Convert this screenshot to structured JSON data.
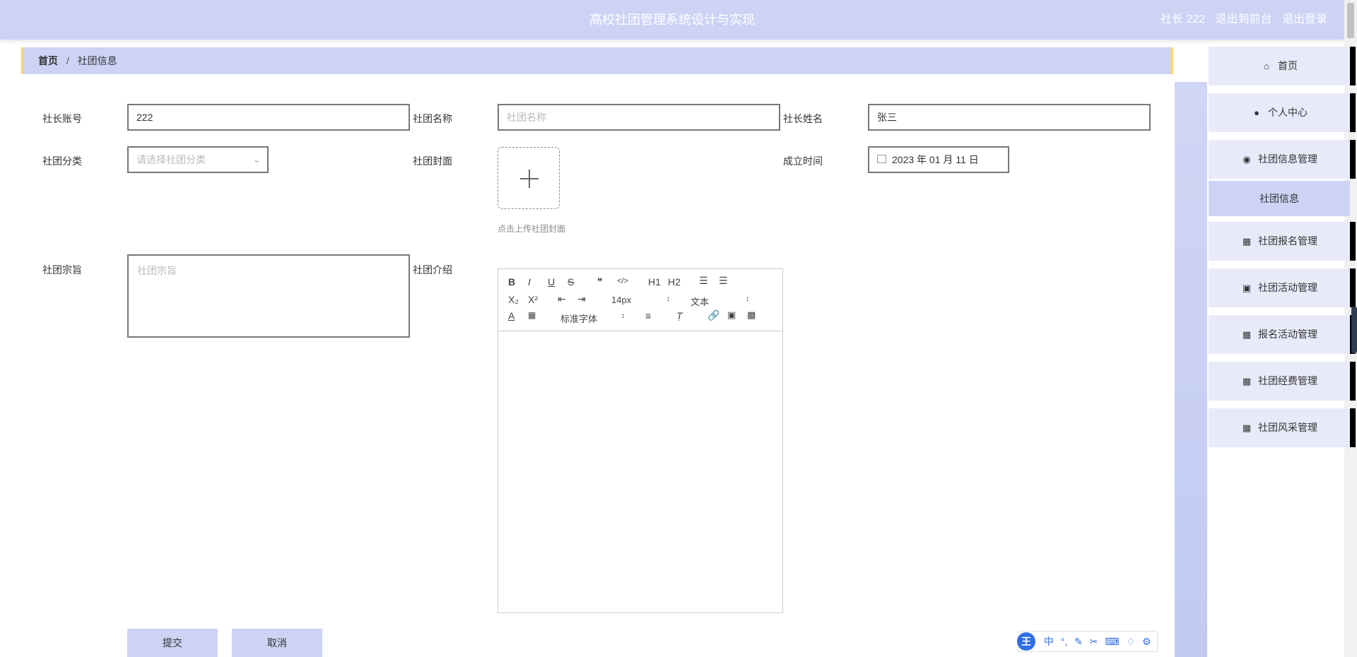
{
  "header": {
    "title": "高校社团管理系统设计与实现",
    "user": "社长 222",
    "links": [
      "退出到前台",
      "退出登录"
    ]
  },
  "breadcrumb": {
    "home": "首页",
    "separator": "/",
    "current": "社团信息"
  },
  "form": {
    "president_account": {
      "label": "社长账号",
      "value": "222"
    },
    "club_name": {
      "label": "社团名称",
      "placeholder": "社团名称"
    },
    "president_name": {
      "label": "社长姓名",
      "value": "张三"
    },
    "category": {
      "label": "社团分类",
      "placeholder": "请选择社团分类"
    },
    "cover": {
      "label": "社团封面",
      "hint": "点击上传社团封面"
    },
    "founded": {
      "label": "成立时间",
      "value": "2023 年 01 月 11 日"
    },
    "purpose": {
      "label": "社团宗旨",
      "placeholder": "社团宗旨"
    },
    "intro": {
      "label": "社团介绍"
    }
  },
  "editor": {
    "buttons_row1": [
      "B",
      "I",
      "U",
      "S",
      "❞",
      "</>",
      "H1",
      "H2"
    ],
    "buttons_row2": [
      "X₂",
      "X²"
    ],
    "font_size": "14px",
    "text_type": "文本",
    "font_family": "标准字体"
  },
  "actions": {
    "submit": "提交",
    "cancel": "取消"
  },
  "sidebar": {
    "items": [
      {
        "label": "首页",
        "icon": "home-icon"
      },
      {
        "label": "个人中心",
        "icon": "user-icon"
      },
      {
        "label": "社团信息管理",
        "icon": "pin-icon"
      },
      {
        "label": "社团报名管理",
        "icon": "grid-icon"
      },
      {
        "label": "社团活动管理",
        "icon": "briefcase-icon"
      },
      {
        "label": "报名活动管理",
        "icon": "grid-icon"
      },
      {
        "label": "社团经费管理",
        "icon": "grid-icon"
      },
      {
        "label": "社团风采管理",
        "icon": "grid-icon"
      }
    ],
    "submenu": "社团信息"
  },
  "ime": {
    "logo": "王",
    "mode": "中"
  },
  "colors": {
    "header_bg": "#cdd3f5",
    "accent_border": "#f6d57a",
    "sidebar_item_bg": "#e8eaf9"
  }
}
